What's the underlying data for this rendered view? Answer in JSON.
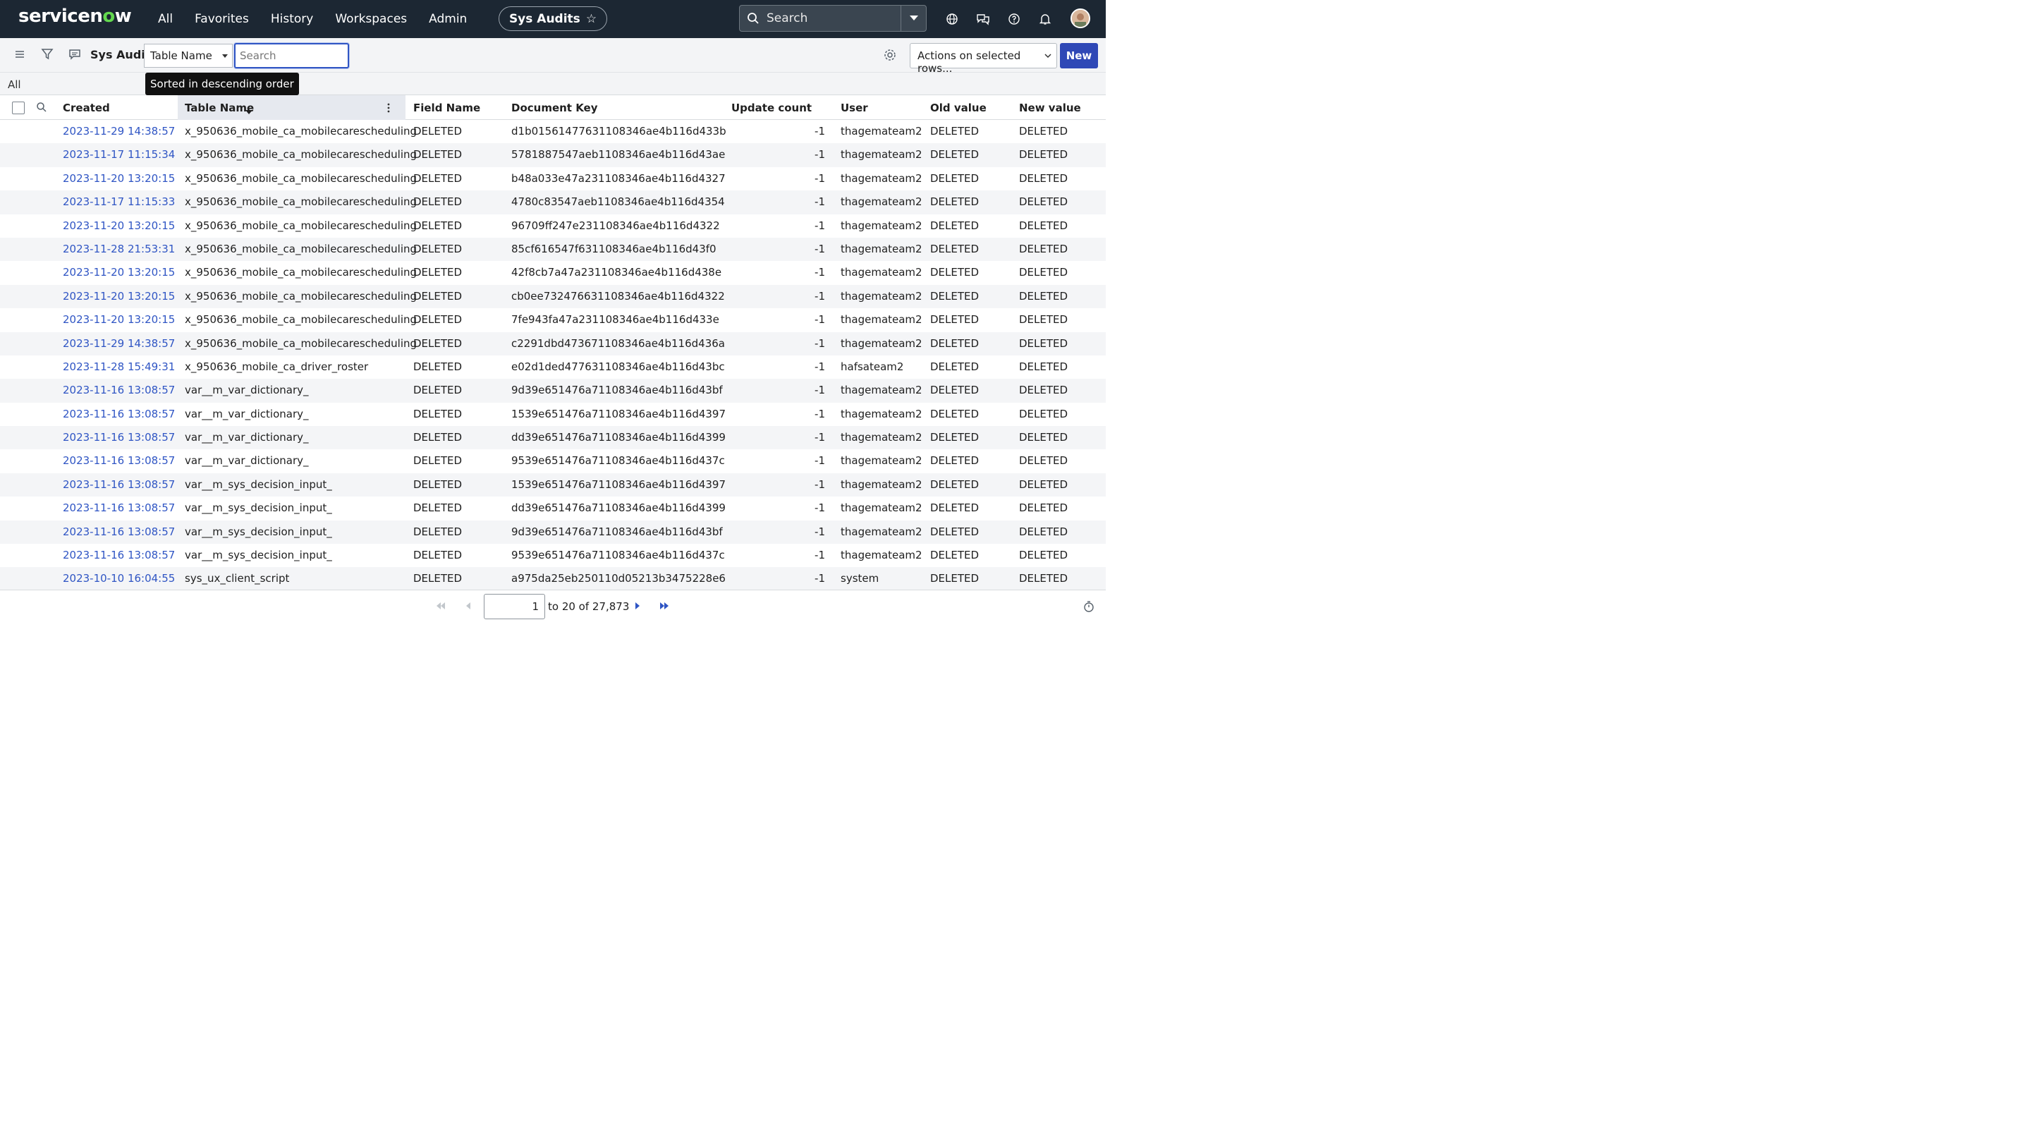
{
  "nav": {
    "logo_pre": "servicen",
    "logo_o": "o",
    "logo_post": "w",
    "links": [
      "All",
      "Favorites",
      "History",
      "Workspaces",
      "Admin"
    ],
    "scope_label": "Sys Audits",
    "search_placeholder": "Search"
  },
  "listbar": {
    "title": "Sys Audits",
    "field_select": "Table Name",
    "search_placeholder": "Search",
    "actions_label": "Actions on selected rows...",
    "new_label": "New"
  },
  "breadcrumb": {
    "all": "All"
  },
  "tooltip": "Sorted in descending order",
  "columns": [
    "Created",
    "Table Name",
    "Field Name",
    "Document Key",
    "Update count",
    "User",
    "Old value",
    "New value"
  ],
  "rows": [
    [
      "2023-11-29 14:38:57",
      "x_950636_mobile_ca_mobilecarescheduling",
      "DELETED",
      "d1b01561477631108346ae4b116d433b",
      "-1",
      "thagemateam2",
      "DELETED",
      "DELETED"
    ],
    [
      "2023-11-17 11:15:34",
      "x_950636_mobile_ca_mobilecarescheduling",
      "DELETED",
      "5781887547aeb1108346ae4b116d43ae",
      "-1",
      "thagemateam2",
      "DELETED",
      "DELETED"
    ],
    [
      "2023-11-20 13:20:15",
      "x_950636_mobile_ca_mobilecarescheduling",
      "DELETED",
      "b48a033e47a231108346ae4b116d4327",
      "-1",
      "thagemateam2",
      "DELETED",
      "DELETED"
    ],
    [
      "2023-11-17 11:15:33",
      "x_950636_mobile_ca_mobilecarescheduling",
      "DELETED",
      "4780c83547aeb1108346ae4b116d4354",
      "-1",
      "thagemateam2",
      "DELETED",
      "DELETED"
    ],
    [
      "2023-11-20 13:20:15",
      "x_950636_mobile_ca_mobilecarescheduling",
      "DELETED",
      "96709ff247e231108346ae4b116d4322",
      "-1",
      "thagemateam2",
      "DELETED",
      "DELETED"
    ],
    [
      "2023-11-28 21:53:31",
      "x_950636_mobile_ca_mobilecarescheduling",
      "DELETED",
      "85cf616547f631108346ae4b116d43f0",
      "-1",
      "thagemateam2",
      "DELETED",
      "DELETED"
    ],
    [
      "2023-11-20 13:20:15",
      "x_950636_mobile_ca_mobilecarescheduling",
      "DELETED",
      "42f8cb7a47a231108346ae4b116d438e",
      "-1",
      "thagemateam2",
      "DELETED",
      "DELETED"
    ],
    [
      "2023-11-20 13:20:15",
      "x_950636_mobile_ca_mobilecarescheduling",
      "DELETED",
      "cb0ee732476631108346ae4b116d4322",
      "-1",
      "thagemateam2",
      "DELETED",
      "DELETED"
    ],
    [
      "2023-11-20 13:20:15",
      "x_950636_mobile_ca_mobilecarescheduling",
      "DELETED",
      "7fe943fa47a231108346ae4b116d433e",
      "-1",
      "thagemateam2",
      "DELETED",
      "DELETED"
    ],
    [
      "2023-11-29 14:38:57",
      "x_950636_mobile_ca_mobilecarescheduling",
      "DELETED",
      "c2291dbd473671108346ae4b116d436a",
      "-1",
      "thagemateam2",
      "DELETED",
      "DELETED"
    ],
    [
      "2023-11-28 15:49:31",
      "x_950636_mobile_ca_driver_roster",
      "DELETED",
      "e02d1ded477631108346ae4b116d43bc",
      "-1",
      "hafsateam2",
      "DELETED",
      "DELETED"
    ],
    [
      "2023-11-16 13:08:57",
      "var__m_var_dictionary_",
      "DELETED",
      "9d39e651476a71108346ae4b116d43bf",
      "-1",
      "thagemateam2",
      "DELETED",
      "DELETED"
    ],
    [
      "2023-11-16 13:08:57",
      "var__m_var_dictionary_",
      "DELETED",
      "1539e651476a71108346ae4b116d4397",
      "-1",
      "thagemateam2",
      "DELETED",
      "DELETED"
    ],
    [
      "2023-11-16 13:08:57",
      "var__m_var_dictionary_",
      "DELETED",
      "dd39e651476a71108346ae4b116d4399",
      "-1",
      "thagemateam2",
      "DELETED",
      "DELETED"
    ],
    [
      "2023-11-16 13:08:57",
      "var__m_var_dictionary_",
      "DELETED",
      "9539e651476a71108346ae4b116d437c",
      "-1",
      "thagemateam2",
      "DELETED",
      "DELETED"
    ],
    [
      "2023-11-16 13:08:57",
      "var__m_sys_decision_input_",
      "DELETED",
      "1539e651476a71108346ae4b116d4397",
      "-1",
      "thagemateam2",
      "DELETED",
      "DELETED"
    ],
    [
      "2023-11-16 13:08:57",
      "var__m_sys_decision_input_",
      "DELETED",
      "dd39e651476a71108346ae4b116d4399",
      "-1",
      "thagemateam2",
      "DELETED",
      "DELETED"
    ],
    [
      "2023-11-16 13:08:57",
      "var__m_sys_decision_input_",
      "DELETED",
      "9d39e651476a71108346ae4b116d43bf",
      "-1",
      "thagemateam2",
      "DELETED",
      "DELETED"
    ],
    [
      "2023-11-16 13:08:57",
      "var__m_sys_decision_input_",
      "DELETED",
      "9539e651476a71108346ae4b116d437c",
      "-1",
      "thagemateam2",
      "DELETED",
      "DELETED"
    ],
    [
      "2023-10-10 16:04:55",
      "sys_ux_client_script",
      "DELETED",
      "a975da25eb250110d05213b3475228e6",
      "-1",
      "system",
      "DELETED",
      "DELETED"
    ]
  ],
  "pagination": {
    "page_value": "1",
    "range_text": "to 20 of 27,873"
  },
  "colors": {
    "nav_bg": "#1c2733",
    "brand_green": "#62d84e",
    "link_blue": "#2f55c4",
    "primary_button": "#2f48b6"
  }
}
